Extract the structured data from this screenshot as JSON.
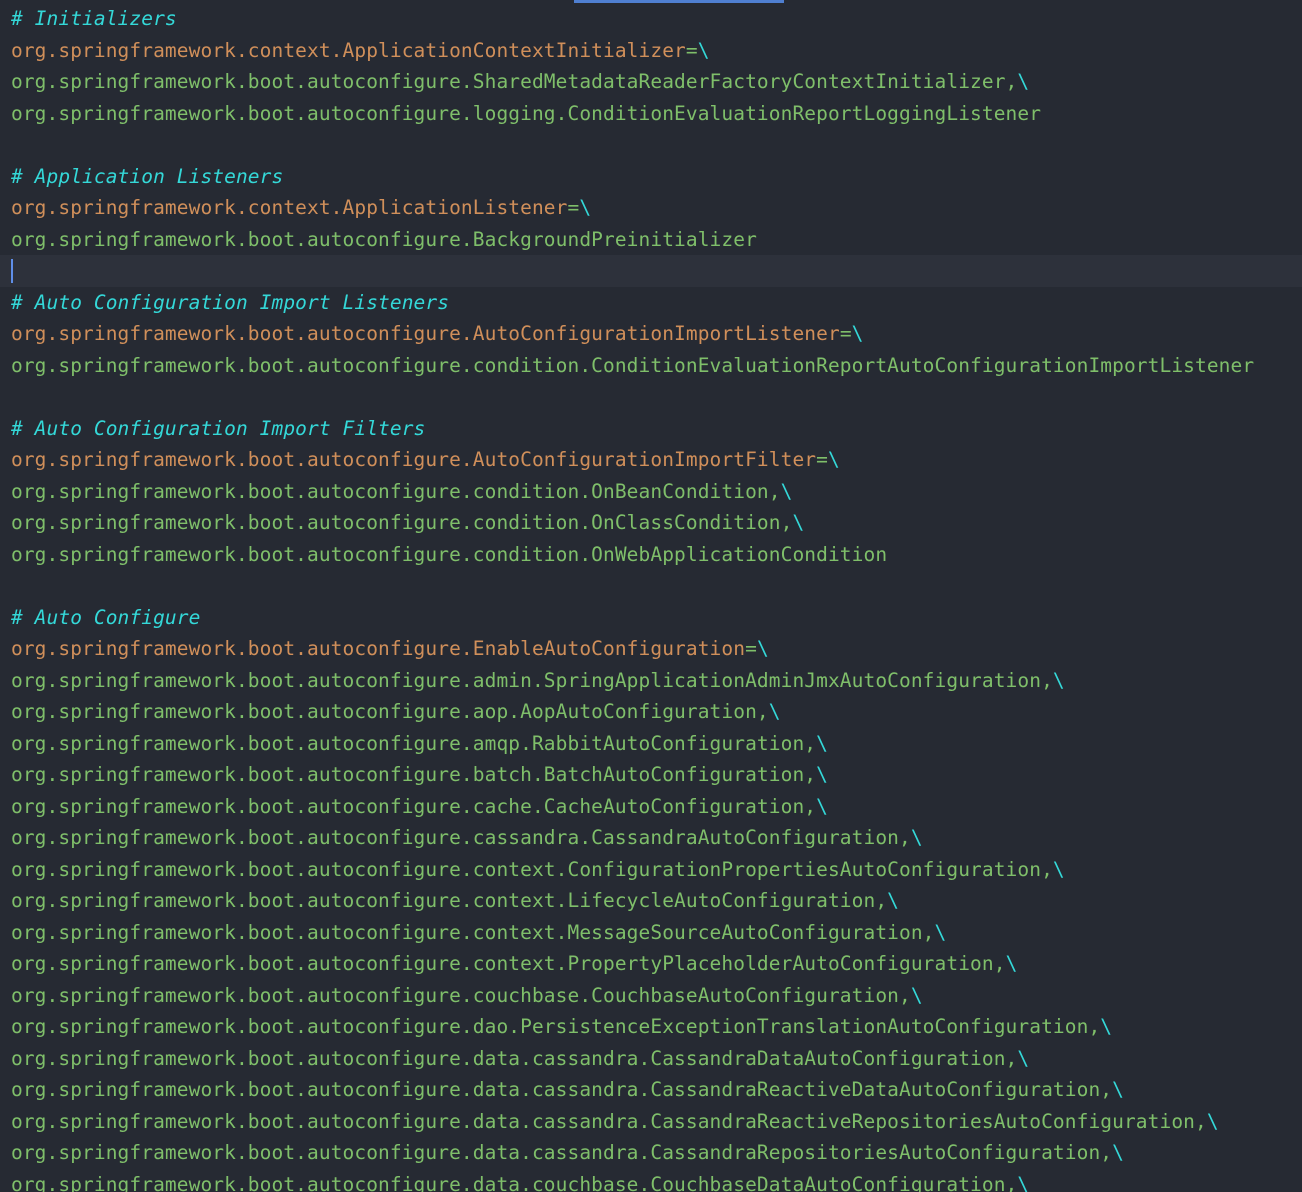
{
  "editor": {
    "lines": [
      {
        "type": "comment",
        "text": "# Initializers"
      },
      {
        "type": "key",
        "key": "org.springframework.context.ApplicationContextInitializer",
        "eq": "=",
        "bs": "\\"
      },
      {
        "type": "value",
        "text": "org.springframework.boot.autoconfigure.SharedMetadataReaderFactoryContextInitializer,",
        "bs": "\\"
      },
      {
        "type": "value",
        "text": "org.springframework.boot.autoconfigure.logging.ConditionEvaluationReportLoggingListener",
        "bs": ""
      },
      {
        "type": "blank"
      },
      {
        "type": "comment",
        "text": "# Application Listeners"
      },
      {
        "type": "key",
        "key": "org.springframework.context.ApplicationListener",
        "eq": "=",
        "bs": "\\"
      },
      {
        "type": "value",
        "text": "org.springframework.boot.autoconfigure.BackgroundPreinitializer",
        "bs": ""
      },
      {
        "type": "current"
      },
      {
        "type": "comment",
        "text": "# Auto Configuration Import Listeners"
      },
      {
        "type": "key",
        "key": "org.springframework.boot.autoconfigure.AutoConfigurationImportListener",
        "eq": "=",
        "bs": "\\"
      },
      {
        "type": "value",
        "text": "org.springframework.boot.autoconfigure.condition.ConditionEvaluationReportAutoConfigurationImportListener",
        "bs": ""
      },
      {
        "type": "blank"
      },
      {
        "type": "comment",
        "text": "# Auto Configuration Import Filters"
      },
      {
        "type": "key",
        "key": "org.springframework.boot.autoconfigure.AutoConfigurationImportFilter",
        "eq": "=",
        "bs": "\\"
      },
      {
        "type": "value",
        "text": "org.springframework.boot.autoconfigure.condition.OnBeanCondition,",
        "bs": "\\"
      },
      {
        "type": "value",
        "text": "org.springframework.boot.autoconfigure.condition.OnClassCondition,",
        "bs": "\\"
      },
      {
        "type": "value",
        "text": "org.springframework.boot.autoconfigure.condition.OnWebApplicationCondition",
        "bs": ""
      },
      {
        "type": "blank"
      },
      {
        "type": "comment",
        "text": "# Auto Configure"
      },
      {
        "type": "key",
        "key": "org.springframework.boot.autoconfigure.EnableAutoConfiguration",
        "eq": "=",
        "bs": "\\"
      },
      {
        "type": "value",
        "text": "org.springframework.boot.autoconfigure.admin.SpringApplicationAdminJmxAutoConfiguration,",
        "bs": "\\"
      },
      {
        "type": "value",
        "text": "org.springframework.boot.autoconfigure.aop.AopAutoConfiguration,",
        "bs": "\\"
      },
      {
        "type": "value",
        "text": "org.springframework.boot.autoconfigure.amqp.RabbitAutoConfiguration,",
        "bs": "\\"
      },
      {
        "type": "value",
        "text": "org.springframework.boot.autoconfigure.batch.BatchAutoConfiguration,",
        "bs": "\\"
      },
      {
        "type": "value",
        "text": "org.springframework.boot.autoconfigure.cache.CacheAutoConfiguration,",
        "bs": "\\"
      },
      {
        "type": "value",
        "text": "org.springframework.boot.autoconfigure.cassandra.CassandraAutoConfiguration,",
        "bs": "\\"
      },
      {
        "type": "value",
        "text": "org.springframework.boot.autoconfigure.context.ConfigurationPropertiesAutoConfiguration,",
        "bs": "\\"
      },
      {
        "type": "value",
        "text": "org.springframework.boot.autoconfigure.context.LifecycleAutoConfiguration,",
        "bs": "\\"
      },
      {
        "type": "value",
        "text": "org.springframework.boot.autoconfigure.context.MessageSourceAutoConfiguration,",
        "bs": "\\"
      },
      {
        "type": "value",
        "text": "org.springframework.boot.autoconfigure.context.PropertyPlaceholderAutoConfiguration,",
        "bs": "\\"
      },
      {
        "type": "value",
        "text": "org.springframework.boot.autoconfigure.couchbase.CouchbaseAutoConfiguration,",
        "bs": "\\"
      },
      {
        "type": "value",
        "text": "org.springframework.boot.autoconfigure.dao.PersistenceExceptionTranslationAutoConfiguration,",
        "bs": "\\"
      },
      {
        "type": "value",
        "text": "org.springframework.boot.autoconfigure.data.cassandra.CassandraDataAutoConfiguration,",
        "bs": "\\"
      },
      {
        "type": "value",
        "text": "org.springframework.boot.autoconfigure.data.cassandra.CassandraReactiveDataAutoConfiguration,",
        "bs": "\\"
      },
      {
        "type": "value",
        "text": "org.springframework.boot.autoconfigure.data.cassandra.CassandraReactiveRepositoriesAutoConfiguration,",
        "bs": "\\"
      },
      {
        "type": "value",
        "text": "org.springframework.boot.autoconfigure.data.cassandra.CassandraRepositoriesAutoConfiguration,",
        "bs": "\\"
      },
      {
        "type": "value",
        "text": "org.springframework.boot.autoconfigure.data.couchbase.CouchbaseDataAutoConfiguration,",
        "bs": "\\"
      }
    ]
  },
  "colors": {
    "background": "#262a33",
    "comment": "#34d8d8",
    "key": "#d08f5a",
    "value": "#7fbf6a",
    "caret": "#5f8ee8",
    "current_line": "#2d313b",
    "tab_indicator": "#4f7fd1"
  }
}
